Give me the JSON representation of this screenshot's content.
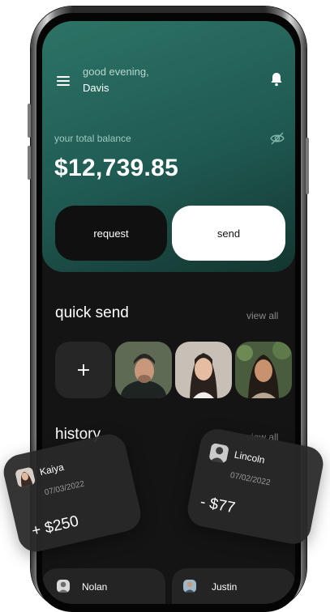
{
  "header": {
    "greeting": "good evening,",
    "user_name": "Davis",
    "menu_icon": "hamburger-menu-icon",
    "notification_icon": "bell-icon"
  },
  "balance": {
    "label": "your total balance",
    "amount": "$12,739.85",
    "visibility_icon": "eye-off-icon"
  },
  "actions": {
    "request_label": "request",
    "send_label": "send"
  },
  "quick_send": {
    "title": "quick send",
    "view_all": "view all",
    "add_label": "+",
    "contacts": [
      "contact-1",
      "contact-2",
      "contact-3",
      "contact-4"
    ]
  },
  "history": {
    "title": "history",
    "view_all": "view all",
    "items": [
      {
        "name": "Kaiya",
        "date": "07/03/2022",
        "amount": "+ $250"
      },
      {
        "name": "Lincoln",
        "date": "07/02/2022",
        "amount": "- $77"
      },
      {
        "name": "Nolan"
      },
      {
        "name": "Justin"
      }
    ]
  },
  "colors": {
    "accent": "#2d7366",
    "background": "#141414",
    "card": "#262626"
  }
}
